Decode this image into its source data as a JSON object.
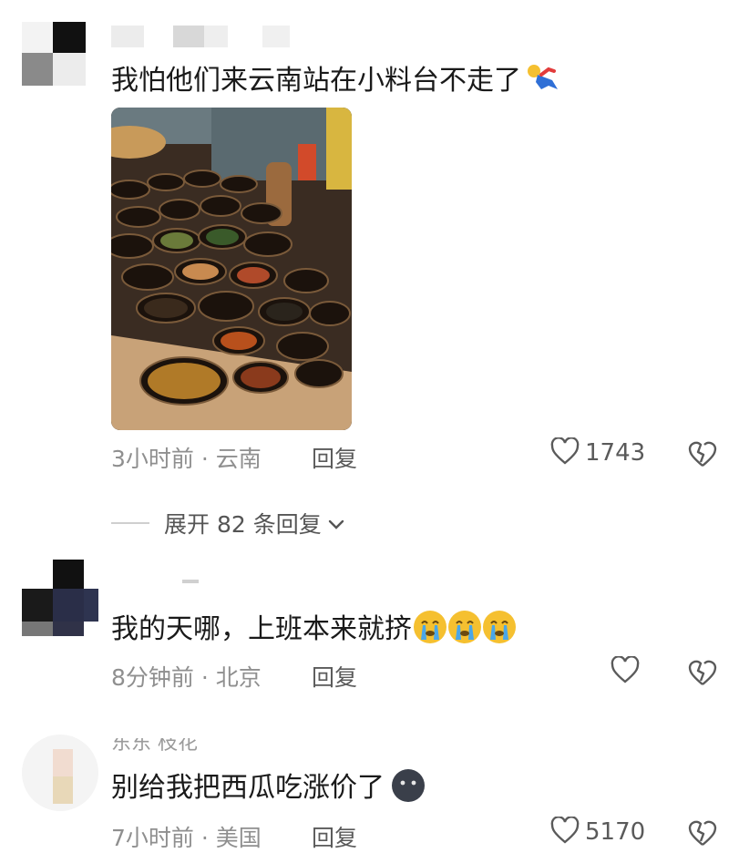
{
  "comments": [
    {
      "text": "我怕他们来云南站在小料台不走了",
      "meta": "3小时前 · 云南",
      "reply_label": "回复",
      "likes": "1743",
      "emoji": "running-person-emoji"
    },
    {
      "text": "我的天哪，上班本来就挤",
      "meta": "8分钟前 · 北京",
      "reply_label": "回复",
      "likes": "",
      "emoji": "crying-face-emoji"
    },
    {
      "username": "东东  枝花",
      "text": "别给我把西瓜吃涨价了",
      "meta": "7小时前 · 美国",
      "reply_label": "回复",
      "likes": "5170",
      "emoji": "dark-face-emoji"
    }
  ],
  "expand_replies": {
    "label": "展开 82 条回复"
  },
  "colors": {
    "meta": "#8f8f8f",
    "heart": "#5a5a5a",
    "emoji_yellow": "#f5c030"
  }
}
